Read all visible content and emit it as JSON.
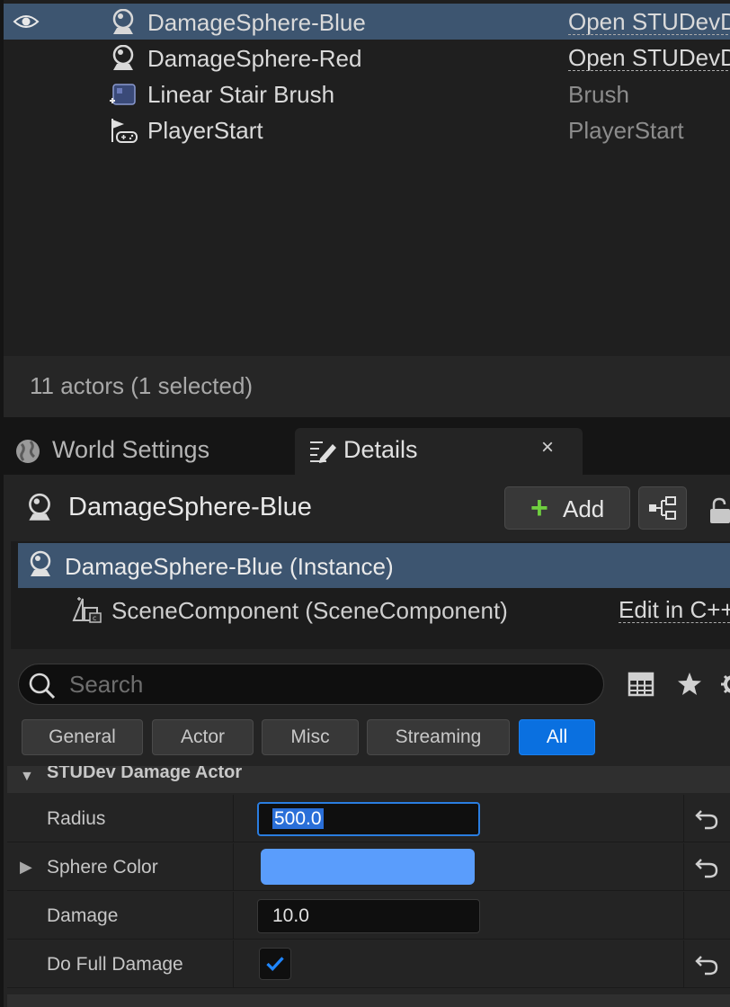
{
  "outliner": {
    "rows": [
      {
        "name": "DamageSphere-Blue",
        "type": "Open STUDevD",
        "selected": true,
        "icon": "sphere-actor-icon"
      },
      {
        "name": "DamageSphere-Red",
        "type": "Open STUDevD",
        "selected": false,
        "icon": "sphere-actor-icon"
      },
      {
        "name": "Linear Stair Brush",
        "type": "Brush",
        "selected": false,
        "icon": "brush-icon"
      },
      {
        "name": "PlayerStart",
        "type": "PlayerStart",
        "selected": false,
        "icon": "player-start-icon"
      }
    ],
    "footer": "11 actors (1 selected)"
  },
  "tabs": {
    "world_settings": "World Settings",
    "details": "Details",
    "close_glyph": "×"
  },
  "details": {
    "actor_name": "DamageSphere-Blue",
    "add_label": "Add",
    "components": {
      "root": "DamageSphere-Blue (Instance)",
      "child": "SceneComponent (SceneComponent)",
      "edit_link": "Edit in C++"
    },
    "search": {
      "placeholder": "Search",
      "value": ""
    },
    "filters": [
      "General",
      "Actor",
      "Misc",
      "Streaming",
      "All"
    ],
    "active_filter": "All",
    "category": "STUDev Damage Actor",
    "properties": {
      "radius": {
        "label": "Radius",
        "value": "500.0"
      },
      "sphere_color": {
        "label": "Sphere Color",
        "color": "#5a9dfc"
      },
      "damage": {
        "label": "Damage",
        "value": "10.0"
      },
      "do_full_damage": {
        "label": "Do Full Damage",
        "checked": true
      }
    }
  },
  "colors": {
    "selection": "#3d5570",
    "accent": "#0a70e0",
    "add_plus": "#6fcf3f"
  }
}
